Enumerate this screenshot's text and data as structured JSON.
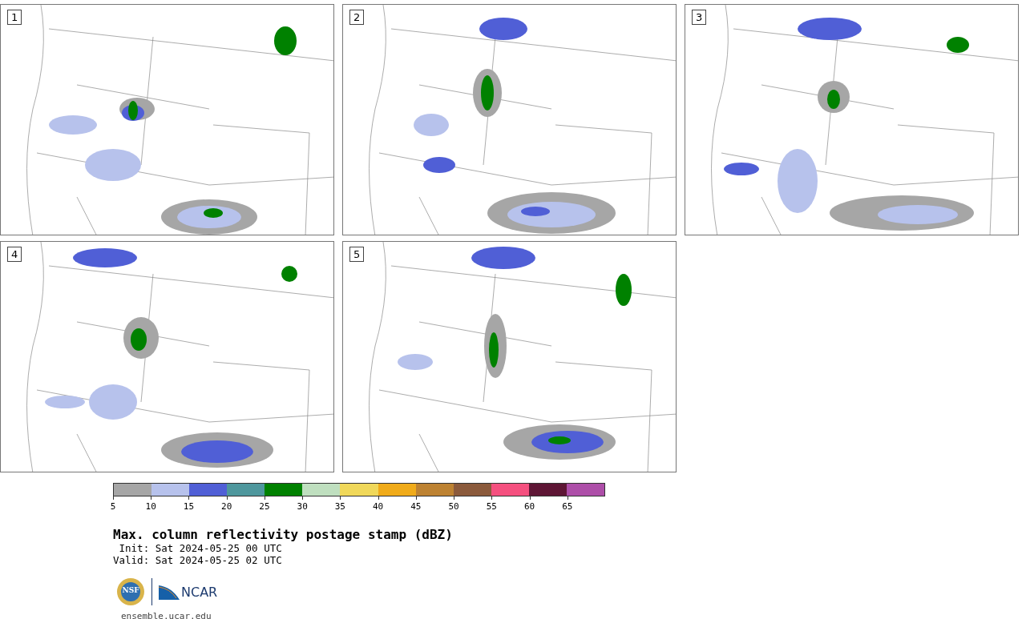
{
  "panels": [
    {
      "label": "1"
    },
    {
      "label": "2"
    },
    {
      "label": "3"
    },
    {
      "label": "4"
    },
    {
      "label": "5"
    }
  ],
  "colorbar": {
    "bins": [
      {
        "color": "#a6a6a6"
      },
      {
        "color": "#b7c2ec"
      },
      {
        "color": "#505fd6"
      },
      {
        "color": "#4e979d"
      },
      {
        "color": "#008100"
      },
      {
        "color": "#bfdfbf"
      },
      {
        "color": "#f0d85a"
      },
      {
        "color": "#f0ab1a"
      },
      {
        "color": "#bd8232"
      },
      {
        "color": "#8b5a3c"
      },
      {
        "color": "#f5507f"
      },
      {
        "color": "#5e1635"
      },
      {
        "color": "#ad4ea8"
      }
    ],
    "ticks": [
      "5",
      "10",
      "15",
      "20",
      "25",
      "30",
      "35",
      "40",
      "45",
      "50",
      "55",
      "60",
      "65"
    ]
  },
  "title": "Max. column reflectivity postage stamp (dBZ)",
  "init": " Init: Sat 2024-05-25 00 UTC",
  "valid": "Valid: Sat 2024-05-25 02 UTC",
  "logos": {
    "nsf": "NSF",
    "ncar": "NCAR"
  },
  "site": "ensemble.ucar.edu"
}
